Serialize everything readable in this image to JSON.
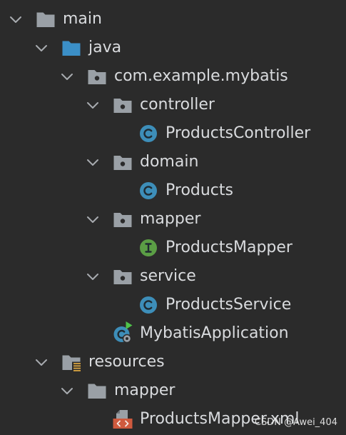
{
  "colors": {
    "background": "#2b2b2b",
    "text": "#d9dbde",
    "chevron": "#a8abb0",
    "folder": "#9aa0a6",
    "source_folder": "#3b8fc7",
    "class": "#3d8eb9",
    "interface": "#5b9e45",
    "resources_marker": "#d9a441",
    "xml": "#cf5a3e",
    "run": "#4fc34a"
  },
  "tree": {
    "label": "main",
    "icon": "folder-icon",
    "expanded": true,
    "children": [
      {
        "label": "java",
        "icon": "source-folder-icon",
        "expanded": true,
        "children": [
          {
            "label": "com.example.mybatis",
            "icon": "package-icon",
            "expanded": true,
            "children": [
              {
                "label": "controller",
                "icon": "package-icon",
                "expanded": true,
                "children": [
                  {
                    "label": "ProductsController",
                    "icon": "class-icon"
                  }
                ]
              },
              {
                "label": "domain",
                "icon": "package-icon",
                "expanded": true,
                "children": [
                  {
                    "label": "Products",
                    "icon": "class-icon"
                  }
                ]
              },
              {
                "label": "mapper",
                "icon": "package-icon",
                "expanded": true,
                "children": [
                  {
                    "label": "ProductsMapper",
                    "icon": "interface-icon"
                  }
                ]
              },
              {
                "label": "service",
                "icon": "package-icon",
                "expanded": true,
                "children": [
                  {
                    "label": "ProductsService",
                    "icon": "class-icon"
                  }
                ]
              },
              {
                "label": "MybatisApplication",
                "icon": "spring-boot-application-icon"
              }
            ]
          }
        ]
      },
      {
        "label": "resources",
        "icon": "resources-folder-icon",
        "expanded": true,
        "children": [
          {
            "label": "mapper",
            "icon": "folder-icon",
            "expanded": true,
            "children": [
              {
                "label": "ProductsMapper.xml",
                "icon": "xml-file-icon"
              }
            ]
          }
        ]
      }
    ]
  },
  "watermark": "CSDN @Awei_404"
}
